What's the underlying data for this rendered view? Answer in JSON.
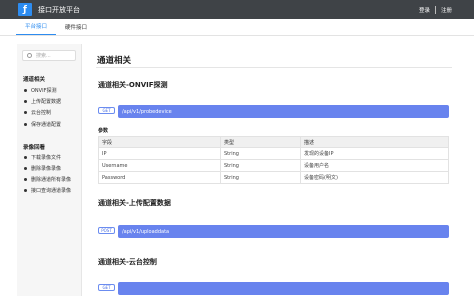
{
  "header": {
    "logo_glyph": "ƒ",
    "title": "接口开放平台",
    "login_label": "登录",
    "register_label": "注册"
  },
  "tabs": [
    {
      "label": "平台接口",
      "active": true
    },
    {
      "label": "硬件接口",
      "active": false
    }
  ],
  "sidebar": {
    "search_placeholder": "搜索...",
    "groups": [
      {
        "title": "通道相关",
        "items": [
          "ONVIF探测",
          "上传配置数据",
          "云台控制",
          "保存通道配置"
        ]
      },
      {
        "title": "录像回看",
        "items": [
          "下载录像文件",
          "删除录像录像",
          "删除通道所有录像",
          "接口查询通道录像"
        ]
      }
    ]
  },
  "main": {
    "page_title": "通道相关",
    "sections": [
      {
        "title": "通道相关-ONVIF探测",
        "method": "GET",
        "url": "/api/v1/probedevice",
        "params_label": "参数",
        "table": {
          "headers": [
            "字段",
            "类型",
            "描述"
          ],
          "rows": [
            [
              "IP",
              "String",
              "发现的设备IP"
            ],
            [
              "Username",
              "String",
              "设备用户名"
            ],
            [
              "Password",
              "String",
              "设备密码(明文)"
            ]
          ]
        }
      },
      {
        "title": "通道相关-上传配置数据",
        "method": "POST",
        "url": "/api/v1/uploaddata"
      },
      {
        "title": "通道相关-云台控制",
        "method": "GET",
        "url": ""
      }
    ]
  },
  "colors": {
    "topbar": "#3f4347",
    "accent": "#2d8cf0",
    "url_bar": "#6883ee"
  }
}
